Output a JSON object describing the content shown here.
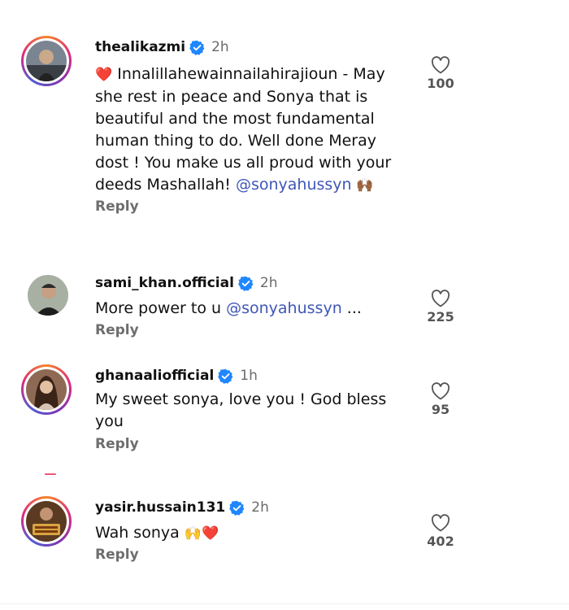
{
  "comments": [
    {
      "username": "thealikazmi",
      "time": "2h",
      "text_prefix": "❤️",
      "text": "Innalillahewainnailahirajioun - May she rest in peace and Sonya that is beautiful and the most fundamental human thing to do. Well done Meray dost ! You make us all proud with your deeds Mashallah! ",
      "mention": "@sonyahussyn",
      "text_suffix": " 🙌🏾",
      "reply": "Reply",
      "likes": "100",
      "ring": true
    },
    {
      "username": "sami_khan.official",
      "time": "2h",
      "text_prefix": "",
      "text": "More power to u ",
      "mention": "@sonyahussyn",
      "text_suffix": " ...",
      "reply": "Reply",
      "likes": "225",
      "ring": false
    },
    {
      "username": "ghanaaliofficial",
      "time": "1h",
      "text_prefix": "",
      "text": "My sweet sonya, love you ! God bless you",
      "mention": "",
      "text_suffix": "",
      "reply": "Reply",
      "likes": "95",
      "ring": true
    },
    {
      "username": "yasir.hussain131",
      "time": "2h",
      "text_prefix": "",
      "text": "Wah sonya ",
      "mention": "",
      "text_suffix": "🙌❤️",
      "reply": "Reply",
      "likes": "402",
      "ring": true
    }
  ],
  "icons": {
    "verified": "verified-badge-icon",
    "like": "heart-outline-icon"
  },
  "colors": {
    "verified": "#1f86ff",
    "mention": "#3f56b6",
    "muted": "#6e6e6e"
  }
}
